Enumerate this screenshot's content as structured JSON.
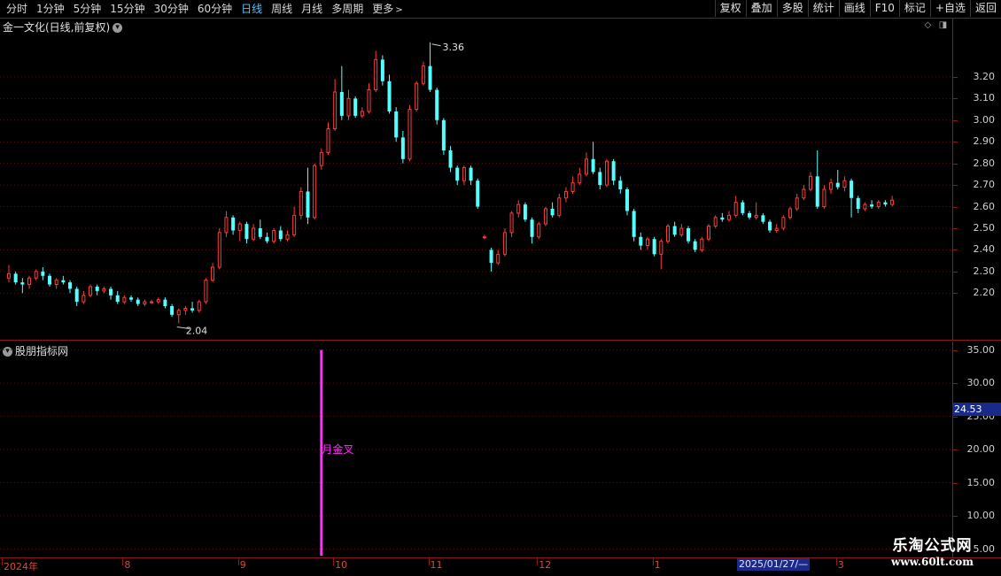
{
  "toolbar": {
    "periods": [
      "分时",
      "1分钟",
      "5分钟",
      "15分钟",
      "30分钟",
      "60分钟",
      "日线",
      "周线",
      "月线",
      "多周期",
      "更多"
    ],
    "active_period": "日线",
    "buttons": [
      "复权",
      "叠加",
      "多股",
      "统计",
      "画线",
      "F10",
      "标记",
      "+自选",
      "返回"
    ]
  },
  "chart": {
    "title": "金一文化(日线,前复权)",
    "high_label": "3.36",
    "low_label": "2.04",
    "price_ticks": [
      "3.20",
      "3.10",
      "3.00",
      "2.90",
      "2.80",
      "2.70",
      "2.60",
      "2.50",
      "2.40",
      "2.30",
      "2.20"
    ]
  },
  "indicator": {
    "title": "股朋指标网",
    "signal_label": "月金叉",
    "current_value": "24.53",
    "ticks": [
      "35.00",
      "30.00",
      "25.00",
      "20.00",
      "15.00",
      "10.00",
      "5.00"
    ]
  },
  "time_axis": {
    "labels": [
      "2024年",
      "8",
      "9",
      "10",
      "11",
      "12",
      "1",
      "3"
    ],
    "cursor_date": "2025/01/27/—"
  },
  "watermark": {
    "line1": "乐淘公式网",
    "line2": "www.60lt.com"
  },
  "colors": {
    "up": "#ff3b3b",
    "down": "#54ffff",
    "signal": "#ff30ff",
    "axis": "#8b1a1a"
  },
  "chart_data": {
    "type": "candlestick",
    "price_ylim": [
      2.05,
      3.4
    ],
    "candles": [
      [
        2.27,
        2.29,
        2.33,
        2.25
      ],
      [
        2.29,
        2.25,
        2.3,
        2.24
      ],
      [
        2.25,
        2.24,
        2.27,
        2.2
      ],
      [
        2.24,
        2.27,
        2.28,
        2.22
      ],
      [
        2.27,
        2.3,
        2.31,
        2.26
      ],
      [
        2.3,
        2.28,
        2.32,
        2.26
      ],
      [
        2.28,
        2.24,
        2.29,
        2.23
      ],
      [
        2.24,
        2.26,
        2.27,
        2.22
      ],
      [
        2.26,
        2.25,
        2.28,
        2.24
      ],
      [
        2.25,
        2.22,
        2.26,
        2.2
      ],
      [
        2.22,
        2.16,
        2.23,
        2.14
      ],
      [
        2.16,
        2.19,
        2.21,
        2.15
      ],
      [
        2.19,
        2.23,
        2.24,
        2.18
      ],
      [
        2.23,
        2.21,
        2.24,
        2.19
      ],
      [
        2.21,
        2.22,
        2.23,
        2.2
      ],
      [
        2.22,
        2.19,
        2.23,
        2.17
      ],
      [
        2.19,
        2.16,
        2.21,
        2.15
      ],
      [
        2.16,
        2.18,
        2.19,
        2.15
      ],
      [
        2.18,
        2.17,
        2.19,
        2.16
      ],
      [
        2.17,
        2.15,
        2.18,
        2.14
      ],
      [
        2.15,
        2.16,
        2.17,
        2.14
      ],
      [
        2.16,
        2.16,
        2.17,
        2.15
      ],
      [
        2.16,
        2.17,
        2.18,
        2.15
      ],
      [
        2.17,
        2.14,
        2.18,
        2.13
      ],
      [
        2.14,
        2.1,
        2.15,
        2.09
      ],
      [
        2.1,
        2.12,
        2.13,
        2.06
      ],
      [
        2.12,
        2.13,
        2.14,
        2.1
      ],
      [
        2.13,
        2.12,
        2.16,
        2.11
      ],
      [
        2.12,
        2.16,
        2.17,
        2.11
      ],
      [
        2.16,
        2.26,
        2.27,
        2.15
      ],
      [
        2.26,
        2.32,
        2.34,
        2.25
      ],
      [
        2.32,
        2.48,
        2.5,
        2.31
      ],
      [
        2.48,
        2.55,
        2.58,
        2.46
      ],
      [
        2.55,
        2.49,
        2.56,
        2.47
      ],
      [
        2.49,
        2.52,
        2.53,
        2.44
      ],
      [
        2.52,
        2.45,
        2.53,
        2.43
      ],
      [
        2.45,
        2.5,
        2.52,
        2.44
      ],
      [
        2.5,
        2.46,
        2.54,
        2.45
      ],
      [
        2.46,
        2.44,
        2.48,
        2.43
      ],
      [
        2.44,
        2.49,
        2.5,
        2.43
      ],
      [
        2.49,
        2.45,
        2.51,
        2.44
      ],
      [
        2.45,
        2.47,
        2.49,
        2.44
      ],
      [
        2.47,
        2.56,
        2.6,
        2.46
      ],
      [
        2.56,
        2.67,
        2.69,
        2.54
      ],
      [
        2.67,
        2.55,
        2.78,
        2.52
      ],
      [
        2.55,
        2.79,
        2.8,
        2.54
      ],
      [
        2.79,
        2.85,
        2.87,
        2.77
      ],
      [
        2.85,
        2.96,
        2.99,
        2.84
      ],
      [
        2.96,
        3.13,
        3.19,
        2.95
      ],
      [
        3.13,
        3.02,
        3.25,
        3.0
      ],
      [
        3.02,
        3.1,
        3.14,
        3.0
      ],
      [
        3.1,
        3.02,
        3.11,
        3.01
      ],
      [
        3.02,
        3.04,
        3.06,
        3.01
      ],
      [
        3.04,
        3.14,
        3.17,
        3.03
      ],
      [
        3.14,
        3.28,
        3.32,
        3.13
      ],
      [
        3.28,
        3.18,
        3.3,
        3.16
      ],
      [
        3.18,
        3.04,
        3.21,
        3.03
      ],
      [
        3.04,
        2.92,
        3.06,
        2.9
      ],
      [
        2.92,
        2.82,
        2.95,
        2.8
      ],
      [
        2.82,
        3.05,
        3.07,
        2.81
      ],
      [
        3.05,
        3.17,
        3.18,
        3.04
      ],
      [
        3.17,
        3.25,
        3.27,
        3.16
      ],
      [
        3.25,
        3.14,
        3.36,
        3.13
      ],
      [
        3.14,
        3.0,
        3.15,
        2.98
      ],
      [
        3.0,
        2.86,
        3.01,
        2.84
      ],
      [
        2.86,
        2.78,
        2.88,
        2.76
      ],
      [
        2.78,
        2.72,
        2.79,
        2.7
      ],
      [
        2.72,
        2.78,
        2.79,
        2.7
      ],
      [
        2.78,
        2.72,
        2.79,
        2.7
      ],
      [
        2.72,
        2.6,
        2.73,
        2.59
      ],
      [
        2.46,
        2.46,
        2.47,
        2.45
      ],
      [
        2.4,
        2.34,
        2.41,
        2.3
      ],
      [
        2.34,
        2.38,
        2.4,
        2.33
      ],
      [
        2.38,
        2.48,
        2.5,
        2.37
      ],
      [
        2.48,
        2.57,
        2.58,
        2.46
      ],
      [
        2.57,
        2.61,
        2.63,
        2.55
      ],
      [
        2.61,
        2.54,
        2.62,
        2.53
      ],
      [
        2.54,
        2.46,
        2.55,
        2.43
      ],
      [
        2.46,
        2.52,
        2.53,
        2.45
      ],
      [
        2.52,
        2.59,
        2.6,
        2.51
      ],
      [
        2.59,
        2.56,
        2.62,
        2.55
      ],
      [
        2.56,
        2.64,
        2.66,
        2.55
      ],
      [
        2.64,
        2.67,
        2.69,
        2.62
      ],
      [
        2.67,
        2.71,
        2.74,
        2.66
      ],
      [
        2.71,
        2.75,
        2.78,
        2.7
      ],
      [
        2.75,
        2.82,
        2.85,
        2.74
      ],
      [
        2.82,
        2.76,
        2.9,
        2.75
      ],
      [
        2.76,
        2.7,
        2.78,
        2.68
      ],
      [
        2.7,
        2.81,
        2.82,
        2.69
      ],
      [
        2.81,
        2.72,
        2.82,
        2.7
      ],
      [
        2.72,
        2.68,
        2.74,
        2.66
      ],
      [
        2.68,
        2.58,
        2.69,
        2.56
      ],
      [
        2.58,
        2.46,
        2.59,
        2.44
      ],
      [
        2.46,
        2.42,
        2.48,
        2.4
      ],
      [
        2.42,
        2.45,
        2.46,
        2.4
      ],
      [
        2.45,
        2.38,
        2.46,
        2.37
      ],
      [
        2.38,
        2.44,
        2.45,
        2.31
      ],
      [
        2.44,
        2.51,
        2.52,
        2.43
      ],
      [
        2.51,
        2.47,
        2.53,
        2.46
      ],
      [
        2.47,
        2.5,
        2.52,
        2.46
      ],
      [
        2.5,
        2.44,
        2.51,
        2.43
      ],
      [
        2.44,
        2.4,
        2.45,
        2.39
      ],
      [
        2.4,
        2.45,
        2.46,
        2.39
      ],
      [
        2.45,
        2.51,
        2.52,
        2.44
      ],
      [
        2.51,
        2.55,
        2.56,
        2.5
      ],
      [
        2.55,
        2.54,
        2.57,
        2.53
      ],
      [
        2.54,
        2.56,
        2.58,
        2.53
      ],
      [
        2.56,
        2.62,
        2.65,
        2.55
      ],
      [
        2.62,
        2.57,
        2.63,
        2.56
      ],
      [
        2.57,
        2.55,
        2.58,
        2.54
      ],
      [
        2.55,
        2.56,
        2.62,
        2.54
      ],
      [
        2.56,
        2.53,
        2.57,
        2.52
      ],
      [
        2.53,
        2.49,
        2.54,
        2.48
      ],
      [
        2.49,
        2.5,
        2.52,
        2.48
      ],
      [
        2.5,
        2.55,
        2.56,
        2.49
      ],
      [
        2.55,
        2.59,
        2.6,
        2.54
      ],
      [
        2.59,
        2.64,
        2.66,
        2.58
      ],
      [
        2.64,
        2.68,
        2.7,
        2.63
      ],
      [
        2.68,
        2.74,
        2.76,
        2.67
      ],
      [
        2.74,
        2.6,
        2.86,
        2.59
      ],
      [
        2.6,
        2.68,
        2.7,
        2.59
      ],
      [
        2.68,
        2.71,
        2.73,
        2.66
      ],
      [
        2.71,
        2.69,
        2.77,
        2.68
      ],
      [
        2.69,
        2.72,
        2.74,
        2.67
      ],
      [
        2.72,
        2.64,
        2.73,
        2.55
      ],
      [
        2.64,
        2.59,
        2.65,
        2.57
      ],
      [
        2.59,
        2.61,
        2.62,
        2.58
      ],
      [
        2.61,
        2.6,
        2.63,
        2.59
      ],
      [
        2.6,
        2.62,
        2.63,
        2.59
      ],
      [
        2.62,
        2.61,
        2.63,
        2.6
      ],
      [
        2.61,
        2.63,
        2.65,
        2.6
      ]
    ],
    "indicator_ylim": [
      4,
      36
    ],
    "signal_bar": {
      "candle_index": 46,
      "from": 4,
      "to": 35
    }
  }
}
